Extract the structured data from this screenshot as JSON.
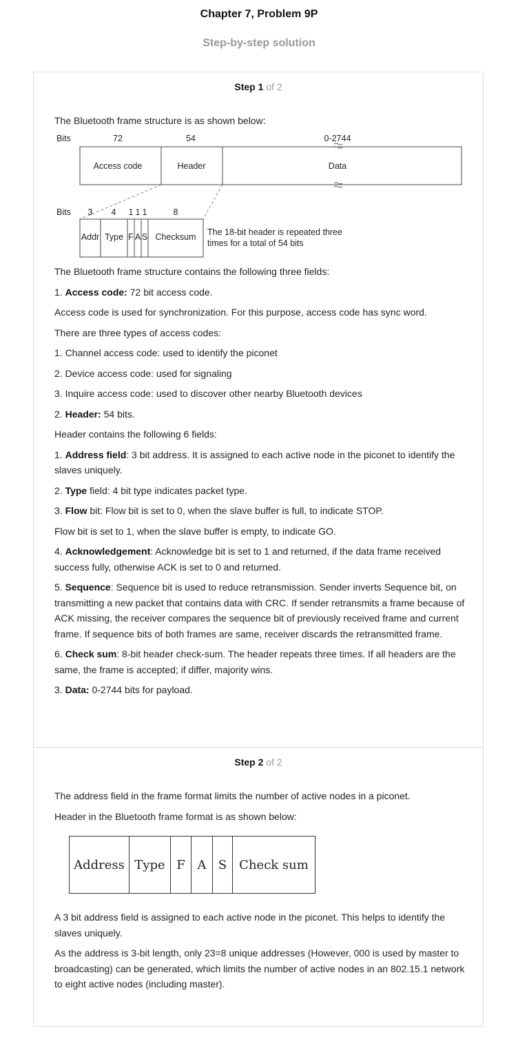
{
  "header": {
    "title": "Chapter 7, Problem 9P",
    "subtitle": "Step-by-step solution"
  },
  "steps": [
    {
      "label": "Step 1",
      "of": "of 2"
    },
    {
      "label": "Step 2",
      "of": "of 2"
    }
  ],
  "step1": {
    "intro": "The Bluetooth frame structure is as shown below:",
    "diagram": {
      "bits_label": "Bits",
      "top_bits": [
        "72",
        "54",
        "0-2744"
      ],
      "fields": [
        "Access code",
        "Header",
        "Data"
      ],
      "header_bits": [
        "3",
        "4",
        "1",
        "1",
        "1",
        "8"
      ],
      "header_fields": [
        "Addr",
        "Type",
        "F",
        "A",
        "S",
        "Checksum"
      ],
      "note_line1": "The 18-bit header is repeated three",
      "note_line2": "times for a total of 54 bits"
    },
    "p1": "The Bluetooth frame structure contains the following three fields:",
    "p2_num": "1. ",
    "p2_bold": "Access code:",
    "p2_text": " 72 bit access code.",
    "p3": "Access code is used for synchronization. For this purpose, access code has sync word.",
    "p4": "There are three types of access codes:",
    "p5": "1. Channel access code: used to identify the piconet",
    "p6": "2. Device access code: used for signaling",
    "p7": "3. Inquire access code: used to discover other nearby Bluetooth devices",
    "p8_num": "2. ",
    "p8_bold": "Header:",
    "p8_text": " 54 bits.",
    "p9": "Header contains the following 6 fields:",
    "p10_num": "1. ",
    "p10_bold": "Address field",
    "p10_text": ": 3 bit address. It is assigned to each active node in the piconet to identify the slaves uniquely.",
    "p11_num": "2. ",
    "p11_bold": "Type",
    "p11_text": " field: 4 bit type indicates packet type.",
    "p12_num": "3. ",
    "p12_bold": "Flow",
    "p12_text": " bit: Flow bit is set to 0, when the slave buffer is full, to indicate STOP.",
    "p13": "Flow bit is set to 1, when the slave buffer is empty, to indicate GO.",
    "p14_num": "4. ",
    "p14_bold": "Acknowledgement",
    "p14_text": ": Acknowledge bit is set to 1 and returned, if the data frame received success fully, otherwise ACK is set to 0 and returned.",
    "p15_num": "5. ",
    "p15_bold": "Sequence",
    "p15_text": ": Sequence bit is used to reduce retransmission. Sender inverts Sequence bit, on transmitting a new packet that contains data with CRC. If sender retransmits a frame because of ACK missing, the receiver compares the sequence bit of previously received frame and current frame. If sequence bits of both frames are same, receiver discards the retransmitted frame.",
    "p16_num": "6. ",
    "p16_bold": "Check sum",
    "p16_text": ": 8-bit header check-sum. The header repeats three times. If all headers are the same, the frame is accepted; if differ, majority wins.",
    "p17_num": "3. ",
    "p17_bold": "Data:",
    "p17_text": " 0-2744 bits for payload."
  },
  "step2": {
    "p1": "The address field in the frame format limits the number of active nodes in a piconet.",
    "p2": "Header in the Bluetooth frame format is as shown below:",
    "header_fields": [
      "Address",
      "Type",
      "F",
      "A",
      "S",
      "Check sum"
    ],
    "p3": "A 3 bit address field is assigned to each active node in the piconet. This helps to identify the slaves uniquely.",
    "p4": "As the address is 3-bit length, only 23=8 unique addresses (However, 000 is used by master to broadcasting) can be generated, which limits the number of active nodes in an 802.15.1 network to eight active nodes (including master)."
  }
}
